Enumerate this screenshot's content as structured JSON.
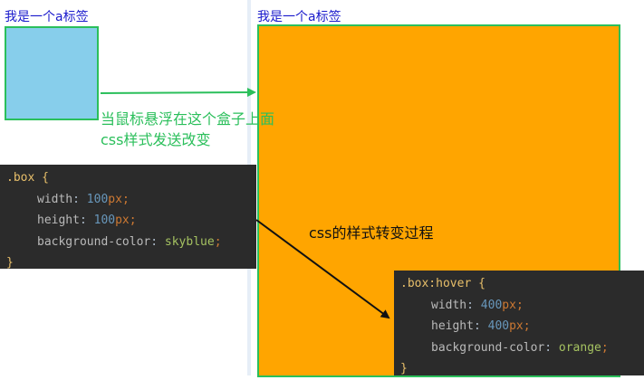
{
  "left_panel": {
    "link_text": "我是一个a标签",
    "box_color": "#87ceeb"
  },
  "right_panel": {
    "link_text": "我是一个a标签",
    "box_color": "#ffa500"
  },
  "annotations": {
    "hover_line1": "当鼠标悬浮在这个盒子上面",
    "hover_line2": "css样式发送改变",
    "process": "css的样式转变过程"
  },
  "code_normal": {
    "selector": ".box",
    "open": "{",
    "close": "}",
    "width_prop": "width",
    "width_num": "100",
    "height_prop": "height",
    "height_num": "100",
    "bg_prop": "background-color",
    "bg_value": "skyblue",
    "unit": "px"
  },
  "code_hover": {
    "selector": ".box:hover",
    "open": "{",
    "close": "}",
    "width_prop": "width",
    "width_num": "400",
    "height_prop": "height",
    "height_num": "400",
    "bg_prop": "background-color",
    "bg_value": "orange",
    "unit": "px"
  },
  "colors": {
    "border_green": "#2bbf5b",
    "link_blue": "#1a1acc",
    "code_bg": "#2b2b2b"
  }
}
